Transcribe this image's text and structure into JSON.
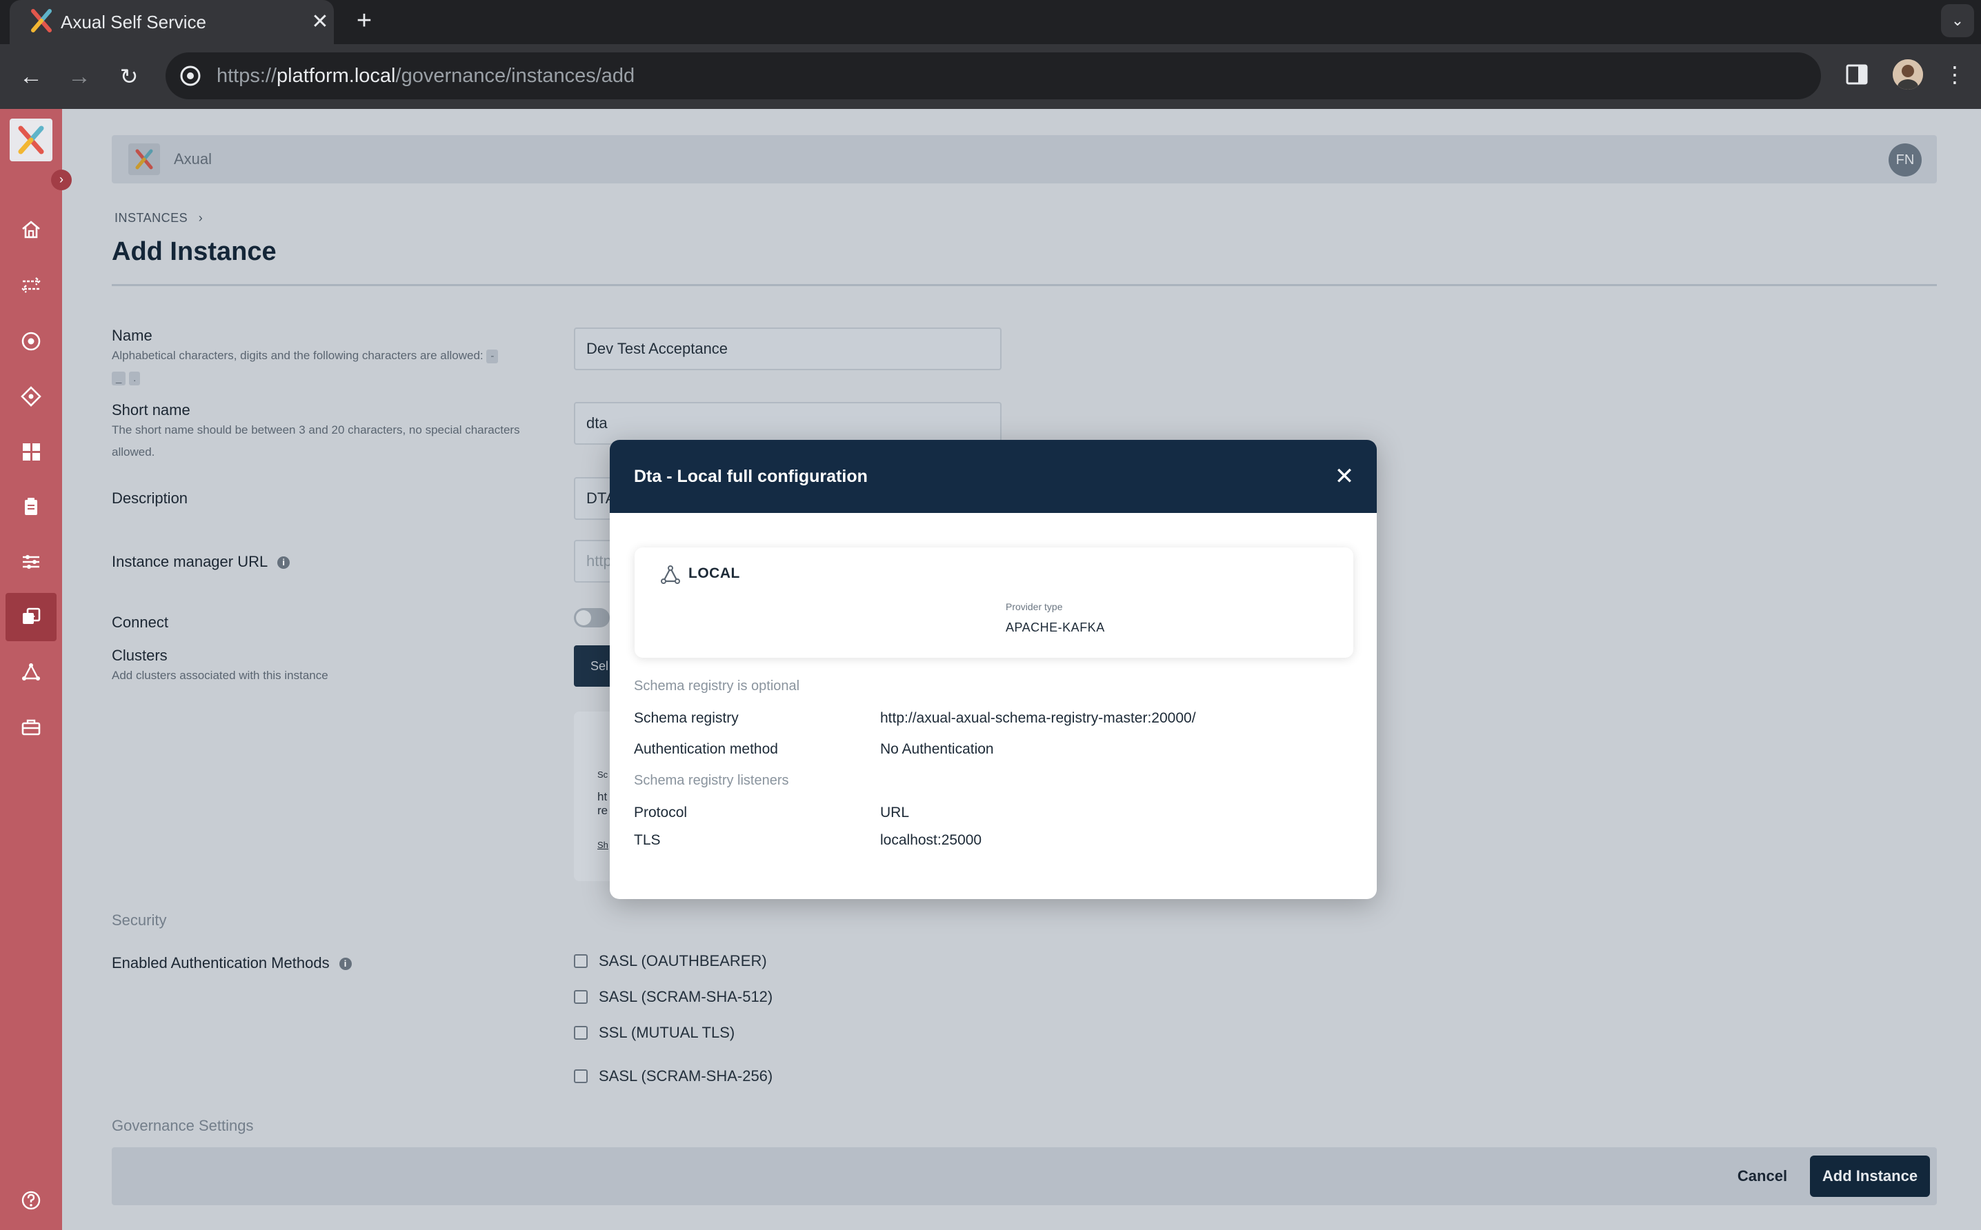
{
  "browser": {
    "tab_title": "Axual Self Service",
    "new_tab": "+",
    "close_tab": "✕",
    "url_prefix": "https://",
    "url_host": "platform.local",
    "url_path": "/governance/instances/add"
  },
  "header": {
    "brand": "Axual",
    "user_initials": "FN"
  },
  "breadcrumb": {
    "root": "INSTANCES",
    "separator": "›"
  },
  "page_title": "Add Instance",
  "form": {
    "name": {
      "label": "Name",
      "help": "Alphabetical characters, digits and the following characters are allowed:",
      "chips": [
        "-",
        "_",
        "."
      ],
      "value": "Dev Test Acceptance"
    },
    "short_name": {
      "label": "Short name",
      "help": "The short name should be between 3 and 20 characters, no special characters allowed.",
      "value": "dta"
    },
    "description": {
      "label": "Description",
      "value": "DTA"
    },
    "instance_manager_url": {
      "label": "Instance manager URL",
      "info": "i",
      "placeholder": "http"
    },
    "connect": {
      "label": "Connect"
    },
    "clusters": {
      "label": "Clusters",
      "help": "Add clusters associated with this instance",
      "select_button": "Sel",
      "card_fragments": [
        "Sc",
        "ht",
        "re",
        "Sh"
      ]
    },
    "security": {
      "section": "Security",
      "auth_label": "Enabled Authentication Methods",
      "info": "i",
      "methods": [
        "SASL (OAUTHBEARER)",
        "SASL (SCRAM-SHA-512)",
        "SSL (MUTUAL TLS)",
        "SASL (SCRAM-SHA-256)"
      ]
    },
    "governance_section": "Governance Settings"
  },
  "footer": {
    "cancel": "Cancel",
    "submit": "Add Instance"
  },
  "modal": {
    "title": "Dta - Local full configuration",
    "close": "✕",
    "provider": {
      "name": "LOCAL",
      "type_label": "Provider type",
      "type_value": "APACHE-KAFKA"
    },
    "schema_optional": "Schema registry is optional",
    "rows": [
      {
        "key": "Schema registry",
        "value": "http://axual-axual-schema-registry-master:20000/"
      },
      {
        "key": "Authentication method",
        "value": "No Authentication"
      }
    ],
    "listeners_section": "Schema registry listeners",
    "listener_header": {
      "key": "Protocol",
      "value": "URL"
    },
    "listener_rows": [
      {
        "key": "TLS",
        "value": "localhost:25000"
      }
    ]
  },
  "colors": {
    "sidebar": "#bd5c64",
    "sidebar_active": "#9c3a43",
    "modal_header": "#142b44",
    "primary_button": "#12273b"
  }
}
